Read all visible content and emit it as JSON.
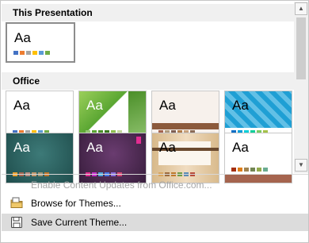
{
  "sections": {
    "this_presentation": "This Presentation",
    "office": "Office"
  },
  "theme_label": "Aa",
  "themes": {
    "current": {
      "colors": [
        "#4472c4",
        "#ed7d31",
        "#a5a5a5",
        "#ffc000",
        "#5b9bd5",
        "#70ad47"
      ]
    },
    "office": [
      {
        "bg": "#ffffff",
        "text": "#000000",
        "colors": [
          "#4472c4",
          "#ed7d31",
          "#a5a5a5",
          "#ffc000",
          "#5b9bd5",
          "#70ad47"
        ]
      },
      {
        "bg": "#ffffff",
        "text": "#ffffff",
        "colors": [
          "#93c572",
          "#5aa632",
          "#4b8f29",
          "#3c7a1f",
          "#8fbe4f",
          "#c3d69b"
        ]
      },
      {
        "bg": "#f4ede6",
        "text": "#000000",
        "colors": [
          "#a5644e",
          "#b19c7d",
          "#7f5f52",
          "#b27d49",
          "#c8a27c",
          "#8b6b55"
        ]
      },
      {
        "bg": "#1f9fd4",
        "text": "#000000",
        "colors": [
          "#0f6fc6",
          "#009dd9",
          "#0bd0d9",
          "#10cf9b",
          "#7cca62",
          "#a5c249"
        ]
      },
      {
        "bg": "#245c5a",
        "text": "#ffffff",
        "colors": [
          "#f0a22e",
          "#a5644e",
          "#b58b80",
          "#c3986d",
          "#a19574",
          "#c17529"
        ]
      },
      {
        "bg": "#4a2a4e",
        "text": "#ffffff",
        "colors": [
          "#e32d91",
          "#c830cc",
          "#4ea6dc",
          "#4775e7",
          "#8971e1",
          "#d54773"
        ]
      },
      {
        "bg": "#e8d2b0",
        "text": "#000000",
        "colors": [
          "#d8a45c",
          "#9e6b3c",
          "#c0792a",
          "#6e9d45",
          "#5b8bb5",
          "#b84c3a"
        ]
      },
      {
        "bg": "#ffffff",
        "text": "#000000",
        "colors": [
          "#a53010",
          "#de7e18",
          "#9f8351",
          "#728653",
          "#92aa4c",
          "#6aac91"
        ]
      }
    ]
  },
  "menu": {
    "enable_updates": "Enable Content Updates from Office.com...",
    "browse": "Browse for Themes...",
    "save": "Save Current Theme..."
  },
  "icons": {
    "scroll_up": "▲",
    "scroll_down": "▼"
  }
}
